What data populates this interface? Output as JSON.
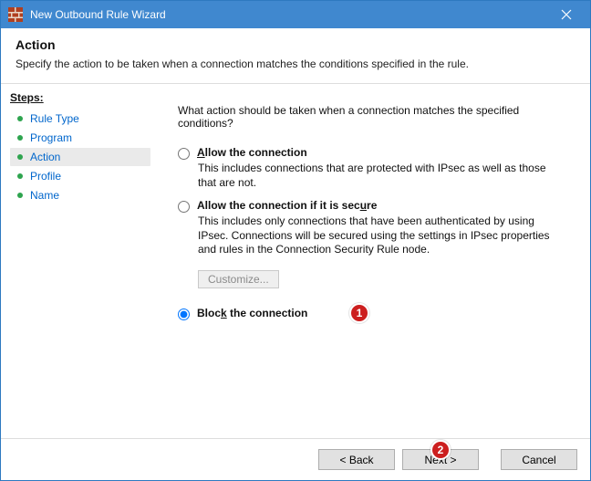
{
  "window": {
    "title": "New Outbound Rule Wizard"
  },
  "header": {
    "title": "Action",
    "subtitle": "Specify the action to be taken when a connection matches the conditions specified in the rule."
  },
  "sidebar": {
    "heading": "Steps:",
    "items": [
      {
        "label": "Rule Type"
      },
      {
        "label": "Program"
      },
      {
        "label": "Action"
      },
      {
        "label": "Profile"
      },
      {
        "label": "Name"
      }
    ]
  },
  "main": {
    "prompt": "What action should be taken when a connection matches the specified conditions?",
    "options": {
      "allow": {
        "label_pre": "",
        "hotkey": "A",
        "label_post": "llow the connection",
        "desc": "This includes connections that are protected with IPsec as well as those that are not."
      },
      "allow_secure": {
        "label_pre": "Allow the connection if it is sec",
        "hotkey": "u",
        "label_post": "re",
        "desc": "This includes only connections that have been authenticated by using IPsec. Connections will be secured using the settings in IPsec properties and rules in the Connection Security Rule node.",
        "customize": "Customize..."
      },
      "block": {
        "label_pre": "Bloc",
        "hotkey": "k",
        "label_post": " the connection"
      }
    }
  },
  "footer": {
    "back": "< Back",
    "next": "Next >",
    "cancel": "Cancel"
  },
  "badges": {
    "one": "1",
    "two": "2"
  },
  "colors": {
    "accent": "#4088cf",
    "link": "#0066cc",
    "badge": "#cc1f1f"
  }
}
